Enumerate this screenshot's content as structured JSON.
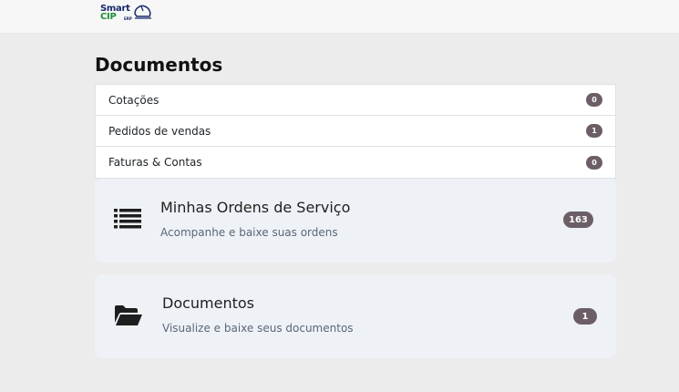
{
  "header": {
    "logo_line1": "Smart",
    "logo_line2": "CIP",
    "logo_tag": "ERP"
  },
  "page": {
    "title": "Documentos"
  },
  "documents": [
    {
      "label": "Cotações",
      "count": "0"
    },
    {
      "label": "Pedidos de vendas",
      "count": "1"
    },
    {
      "label": "Faturas & Contas",
      "count": "0"
    }
  ],
  "cards": [
    {
      "title": "Minhas Ordens de Serviço",
      "subtitle": "Acompanhe e baixe suas ordens",
      "count": "163",
      "icon": "list-icon"
    },
    {
      "title": "Documentos",
      "subtitle": "Visualize e baixe seus documentos",
      "count": "1",
      "icon": "folder-open-icon"
    }
  ],
  "colors": {
    "badge": "#6c5e66",
    "card_bg": "#eef2f6",
    "page_bg": "#ececec"
  }
}
